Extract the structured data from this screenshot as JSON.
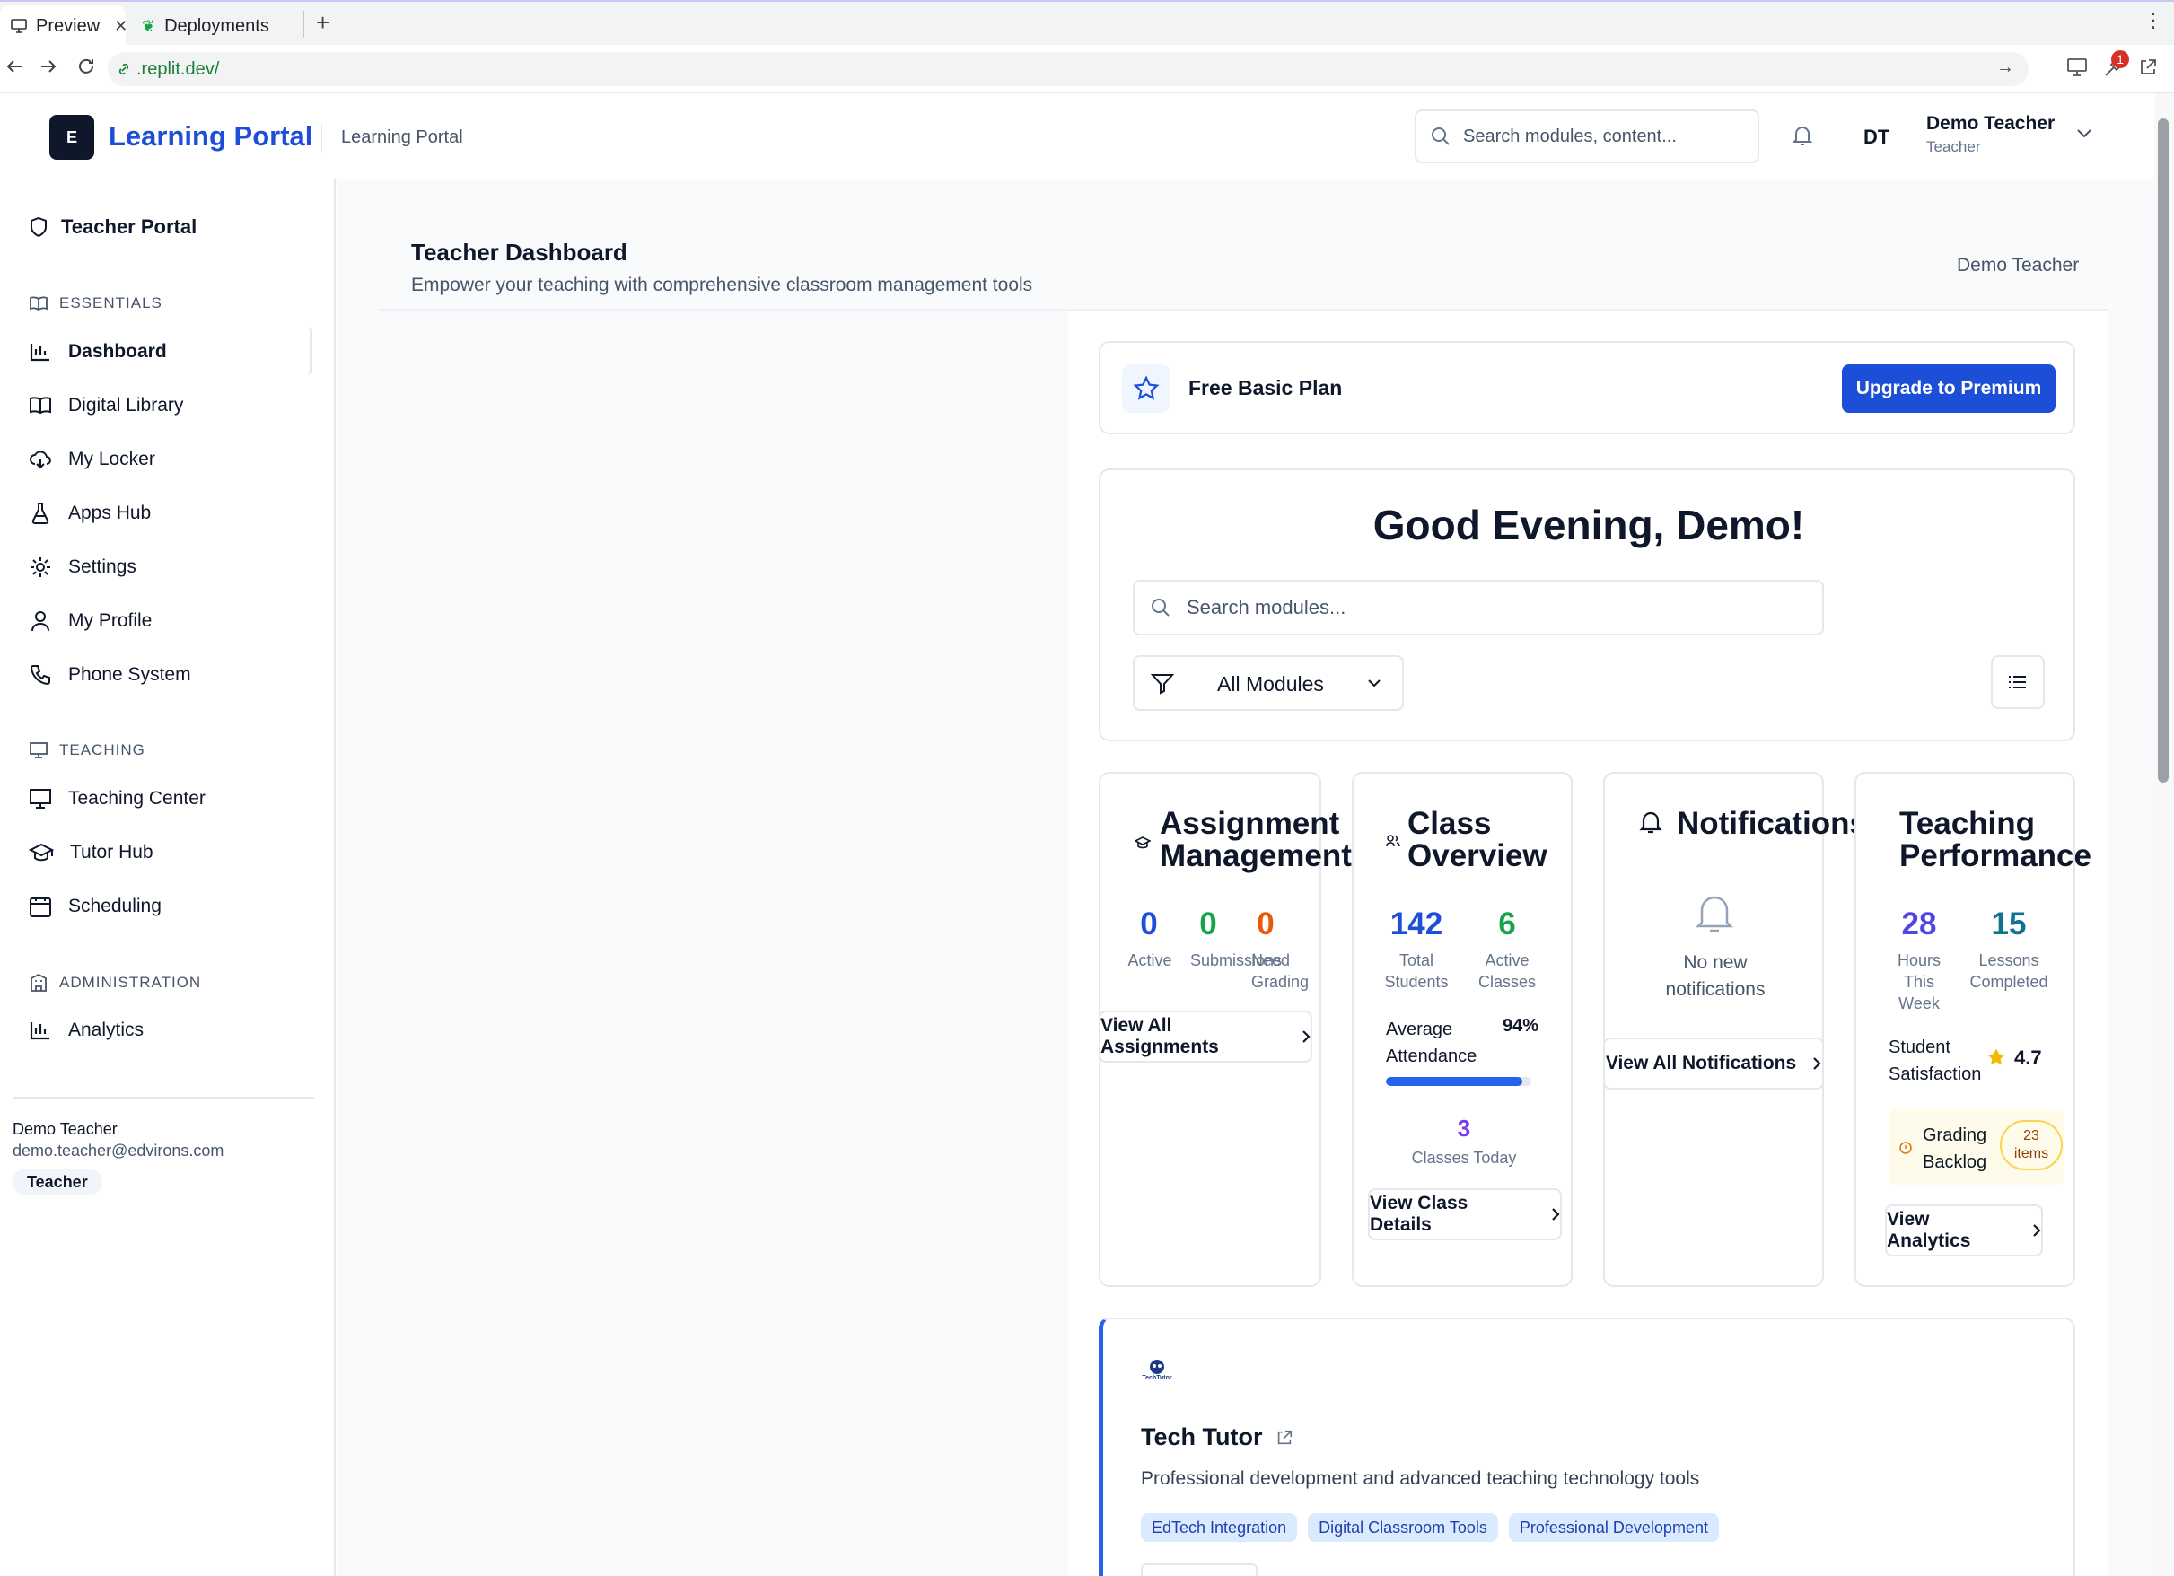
{
  "browser": {
    "tabs": [
      {
        "label": "Preview",
        "icon": "monitor-icon"
      },
      {
        "label": "Deployments",
        "icon": "tree-icon"
      }
    ],
    "address": ".replit.dev/",
    "notification_count": "1"
  },
  "header": {
    "logo_letter": "E",
    "brand": "Learning Portal",
    "subtitle": "Learning Portal",
    "search_placeholder": "Search modules, content...",
    "user_initials": "DT",
    "user_name": "Demo Teacher",
    "user_role": "Teacher"
  },
  "sidebar": {
    "portal_title": "Teacher Portal",
    "sections": [
      {
        "title": "ESSENTIALS",
        "items": [
          "Dashboard",
          "Digital Library",
          "My Locker",
          "Apps Hub",
          "Settings",
          "My Profile",
          "Phone System"
        ]
      },
      {
        "title": "TEACHING",
        "items": [
          "Teaching Center",
          "Tutor Hub",
          "Scheduling"
        ]
      },
      {
        "title": "ADMINISTRATION",
        "items": [
          "Analytics"
        ]
      }
    ],
    "user": {
      "name": "Demo Teacher",
      "email": "demo.teacher@edvirons.com",
      "role": "Teacher"
    }
  },
  "page": {
    "title": "Teacher Dashboard",
    "subtitle": "Empower your teaching with comprehensive classroom management tools",
    "user_label": "Demo Teacher"
  },
  "plan": {
    "name": "Free Basic Plan",
    "upgrade_label": "Upgrade to Premium"
  },
  "greeting": {
    "text": "Good Evening, Demo!",
    "search_placeholder": "Search modules...",
    "filter_value": "All Modules"
  },
  "cards": {
    "assignments": {
      "title_line1": "Assignment",
      "title_line2": "Management",
      "stats": [
        {
          "value": "0",
          "label": "Active",
          "color": "#1d4ed8"
        },
        {
          "value": "0",
          "label": "Submissions",
          "color": "#16a34a"
        },
        {
          "value": "0",
          "label_line1": "Need",
          "label_line2": "Grading",
          "color": "#ea580c"
        }
      ],
      "button": "View All Assignments"
    },
    "classes": {
      "title_line1": "Class",
      "title_line2": "Overview",
      "total_students": "142",
      "total_students_l1": "Total",
      "total_students_l2": "Students",
      "active_classes": "6",
      "active_classes_l1": "Active",
      "active_classes_l2": "Classes",
      "attendance_label_l1": "Average",
      "attendance_label_l2": "Attendance",
      "attendance_value": "94%",
      "attendance_fraction": 0.94,
      "classes_today": "3",
      "classes_today_label": "Classes Today",
      "button": "View Class Details"
    },
    "notifications": {
      "title": "Notifications",
      "empty_l1": "No new",
      "empty_l2": "notifications",
      "button": "View All Notifications"
    },
    "performance": {
      "title_line1": "Teaching",
      "title_line2": "Performance",
      "hours": "28",
      "hours_l1": "Hours",
      "hours_l2": "This",
      "hours_l3": "Week",
      "lessons": "15",
      "lessons_l1": "Lessons",
      "lessons_l2": "Completed",
      "satisfaction_l1": "Student",
      "satisfaction_l2": "Satisfaction",
      "satisfaction_value": "4.7",
      "backlog_l1": "Grading",
      "backlog_l2": "Backlog",
      "backlog_count_l1": "23",
      "backlog_count_l2": "items",
      "button": "View Analytics"
    }
  },
  "module": {
    "logo_text": "TechTutor",
    "title": "Tech Tutor",
    "description": "Professional development and advanced teaching technology tools",
    "tags": [
      "EdTech Integration",
      "Digital Classroom Tools",
      "Professional Development"
    ]
  },
  "colors": {
    "accent": "#1d4ed8",
    "dark": "#0f172a",
    "purple": "#7c3aed",
    "amber": "#f59e0b"
  }
}
